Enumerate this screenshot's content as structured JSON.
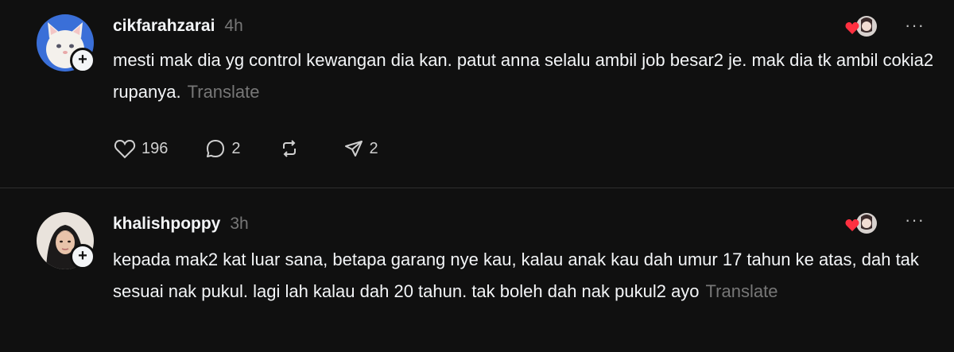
{
  "posts": [
    {
      "username": "cikfarahzarai",
      "timestamp": "4h",
      "text": "mesti mak dia yg control kewangan dia kan. patut anna selalu ambil job besar2 je. mak dia tk ambil cokia2 rupanya.",
      "translate_label": "Translate",
      "actions": {
        "likes": "196",
        "replies": "2",
        "shares": "2"
      }
    },
    {
      "username": "khalishpoppy",
      "timestamp": "3h",
      "text": "kepada mak2 kat luar sana, betapa garang nye kau, kalau anak kau dah umur 17 tahun ke atas, dah tak sesuai nak pukul. lagi lah kalau dah 20 tahun. tak boleh dah nak pukul2 ayo",
      "translate_label": "Translate"
    }
  ],
  "icons": {
    "follow": "plus-icon",
    "more": "more-horizontal-icon",
    "like": "heart-icon",
    "reply": "comment-icon",
    "repost": "repost-icon",
    "share": "send-icon",
    "liked_indicator": "red-heart-icon"
  },
  "colors": {
    "background": "#101010",
    "text": "#f3f5f7",
    "muted": "#777777",
    "heart_red": "#ff3040"
  }
}
